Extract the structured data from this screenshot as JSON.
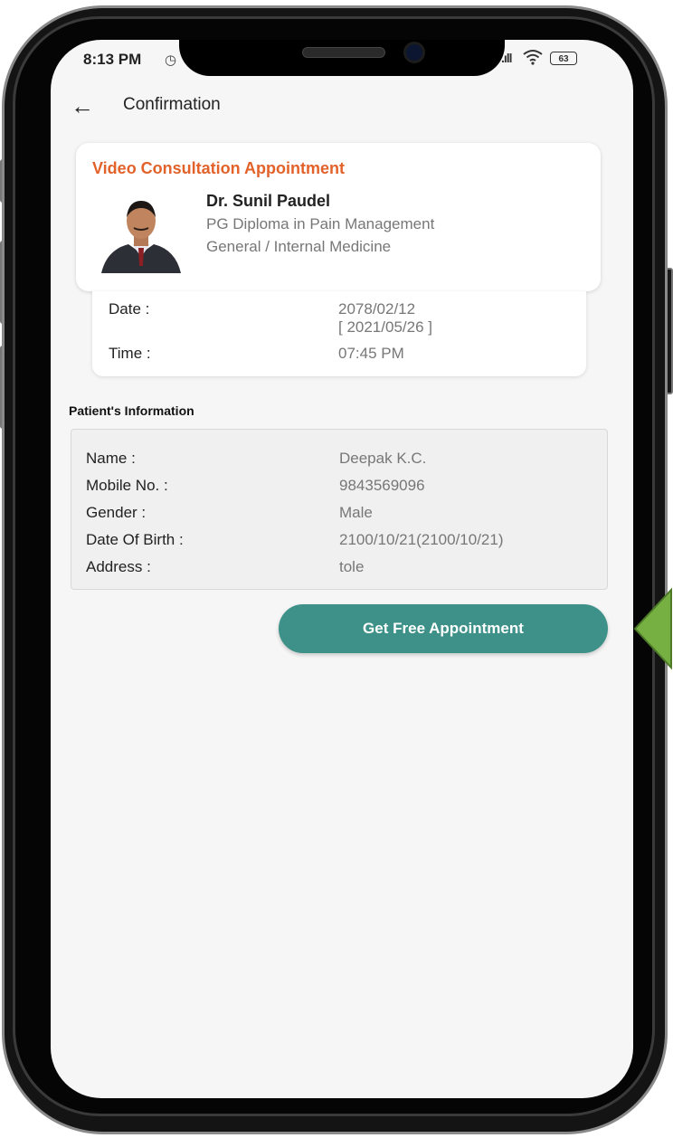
{
  "status_bar": {
    "time": "8:13 PM",
    "battery": "63"
  },
  "header": {
    "title": "Confirmation"
  },
  "appointment": {
    "type": "Video Consultation Appointment",
    "doctor": {
      "name": "Dr. Sunil Paudel",
      "qualification": "PG Diploma in Pain Management",
      "specialty": "General  / Internal Medicine"
    },
    "date_label": "Date :",
    "date_bs": "2078/02/12",
    "date_ad": "[ 2021/05/26 ]",
    "time_label": "Time :",
    "time_value": "07:45 PM"
  },
  "patient": {
    "section_title": "Patient's Information",
    "fields": [
      {
        "label": "Name :",
        "value": "Deepak K.C."
      },
      {
        "label": "Mobile No. :",
        "value": "9843569096"
      },
      {
        "label": "Gender :",
        "value": "Male"
      },
      {
        "label": "Date Of Birth :",
        "value": "2100/10/21(2100/10/21)"
      },
      {
        "label": "Address :",
        "value": "tole"
      }
    ]
  },
  "cta": {
    "label": "Get Free Appointment"
  },
  "colors": {
    "accent_orange": "#e2622a",
    "button_teal": "#3d9188",
    "arrow_green": "#76b043"
  },
  "icons": {
    "back": "arrow-left-icon",
    "alarm": "alarm-clock-icon",
    "signal": "signal-icon",
    "wifi": "wifi-icon",
    "battery": "battery-icon"
  }
}
